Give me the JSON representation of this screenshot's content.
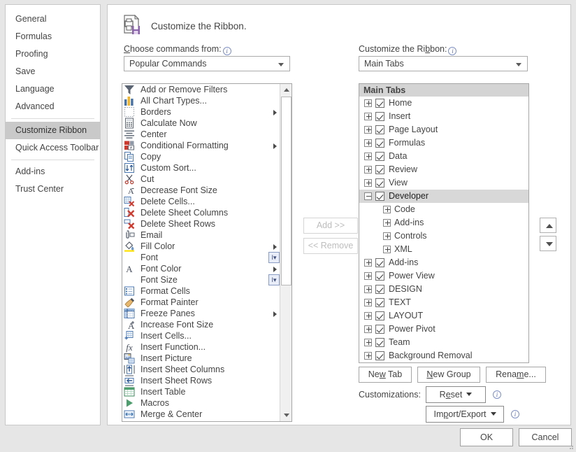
{
  "sidebar": {
    "items": [
      {
        "label": "General",
        "selected": false
      },
      {
        "label": "Formulas",
        "selected": false
      },
      {
        "label": "Proofing",
        "selected": false
      },
      {
        "label": "Save",
        "selected": false
      },
      {
        "label": "Language",
        "selected": false
      },
      {
        "label": "Advanced",
        "selected": false
      },
      {
        "label": "Customize Ribbon",
        "selected": true
      },
      {
        "label": "Quick Access Toolbar",
        "selected": false
      },
      {
        "label": "Add-ins",
        "selected": false
      },
      {
        "label": "Trust Center",
        "selected": false
      }
    ]
  },
  "header": {
    "title": "Customize the Ribbon.",
    "icon": "printer-save-icon"
  },
  "left_panel": {
    "label": "Choose commands from:",
    "label_accel": "C",
    "combo_value": "Popular Commands",
    "commands": [
      {
        "label": "Add or Remove Filters",
        "icon": "filter-icon",
        "submenu": false,
        "dropdown": false
      },
      {
        "label": "All Chart Types...",
        "icon": "chart-icon",
        "submenu": false,
        "dropdown": false
      },
      {
        "label": "Borders",
        "icon": "borders-icon",
        "submenu": true,
        "dropdown": false
      },
      {
        "label": "Calculate Now",
        "icon": "calculator-icon",
        "submenu": false,
        "dropdown": false
      },
      {
        "label": "Center",
        "icon": "center-align-icon",
        "submenu": false,
        "dropdown": false
      },
      {
        "label": "Conditional Formatting",
        "icon": "conditional-format-icon",
        "submenu": true,
        "dropdown": false
      },
      {
        "label": "Copy",
        "icon": "copy-icon",
        "submenu": false,
        "dropdown": false
      },
      {
        "label": "Custom Sort...",
        "icon": "sort-icon",
        "submenu": false,
        "dropdown": false
      },
      {
        "label": "Cut",
        "icon": "scissors-icon",
        "submenu": false,
        "dropdown": false
      },
      {
        "label": "Decrease Font Size",
        "icon": "decrease-font-icon",
        "submenu": false,
        "dropdown": false
      },
      {
        "label": "Delete Cells...",
        "icon": "delete-cells-icon",
        "submenu": false,
        "dropdown": false
      },
      {
        "label": "Delete Sheet Columns",
        "icon": "delete-columns-icon",
        "submenu": false,
        "dropdown": false
      },
      {
        "label": "Delete Sheet Rows",
        "icon": "delete-rows-icon",
        "submenu": false,
        "dropdown": false
      },
      {
        "label": "Email",
        "icon": "email-icon",
        "submenu": false,
        "dropdown": false
      },
      {
        "label": "Fill Color",
        "icon": "fill-color-icon",
        "submenu": true,
        "dropdown": false
      },
      {
        "label": "Font",
        "icon": "none",
        "submenu": false,
        "dropdown": true
      },
      {
        "label": "Font Color",
        "icon": "font-color-icon",
        "submenu": true,
        "dropdown": false
      },
      {
        "label": "Font Size",
        "icon": "none",
        "submenu": false,
        "dropdown": true
      },
      {
        "label": "Format Cells",
        "icon": "format-cells-icon",
        "submenu": false,
        "dropdown": false
      },
      {
        "label": "Format Painter",
        "icon": "format-painter-icon",
        "submenu": false,
        "dropdown": false
      },
      {
        "label": "Freeze Panes",
        "icon": "freeze-panes-icon",
        "submenu": true,
        "dropdown": false
      },
      {
        "label": "Increase Font Size",
        "icon": "increase-font-icon",
        "submenu": false,
        "dropdown": false
      },
      {
        "label": "Insert Cells...",
        "icon": "insert-cells-icon",
        "submenu": false,
        "dropdown": false
      },
      {
        "label": "Insert Function...",
        "icon": "function-icon",
        "submenu": false,
        "dropdown": false
      },
      {
        "label": "Insert Picture",
        "icon": "picture-icon",
        "submenu": false,
        "dropdown": false
      },
      {
        "label": "Insert Sheet Columns",
        "icon": "insert-columns-icon",
        "submenu": false,
        "dropdown": false
      },
      {
        "label": "Insert Sheet Rows",
        "icon": "insert-rows-icon",
        "submenu": false,
        "dropdown": false
      },
      {
        "label": "Insert Table",
        "icon": "table-icon",
        "submenu": false,
        "dropdown": false
      },
      {
        "label": "Macros",
        "icon": "macros-play-icon",
        "submenu": false,
        "dropdown": false
      },
      {
        "label": "Merge & Center",
        "icon": "merge-center-icon",
        "submenu": false,
        "dropdown": false
      }
    ]
  },
  "middle_buttons": {
    "add_label": "Add >>",
    "add_enabled": false,
    "remove_label": "<< Remove",
    "remove_enabled": false
  },
  "right_panel": {
    "label": "Customize the Ribbon:",
    "label_accel": "b",
    "combo_value": "Main Tabs",
    "tree_header": "Main Tabs",
    "tree": [
      {
        "label": "Home",
        "level": 0,
        "checked": true,
        "expander": "plus",
        "selected": false
      },
      {
        "label": "Insert",
        "level": 0,
        "checked": true,
        "expander": "plus",
        "selected": false
      },
      {
        "label": "Page Layout",
        "level": 0,
        "checked": true,
        "expander": "plus",
        "selected": false
      },
      {
        "label": "Formulas",
        "level": 0,
        "checked": true,
        "expander": "plus",
        "selected": false
      },
      {
        "label": "Data",
        "level": 0,
        "checked": true,
        "expander": "plus",
        "selected": false
      },
      {
        "label": "Review",
        "level": 0,
        "checked": true,
        "expander": "plus",
        "selected": false
      },
      {
        "label": "View",
        "level": 0,
        "checked": true,
        "expander": "plus",
        "selected": false
      },
      {
        "label": "Developer",
        "level": 0,
        "checked": true,
        "expander": "minus",
        "selected": true
      },
      {
        "label": "Code",
        "level": 1,
        "checked": false,
        "expander": "plus",
        "selected": false
      },
      {
        "label": "Add-ins",
        "level": 1,
        "checked": false,
        "expander": "plus",
        "selected": false
      },
      {
        "label": "Controls",
        "level": 1,
        "checked": false,
        "expander": "plus",
        "selected": false
      },
      {
        "label": "XML",
        "level": 1,
        "checked": false,
        "expander": "plus",
        "selected": false
      },
      {
        "label": "Add-ins",
        "level": 0,
        "checked": true,
        "expander": "plus",
        "selected": false
      },
      {
        "label": "Power View",
        "level": 0,
        "checked": true,
        "expander": "plus",
        "selected": false
      },
      {
        "label": "DESIGN",
        "level": 0,
        "checked": true,
        "expander": "plus",
        "selected": false
      },
      {
        "label": "TEXT",
        "level": 0,
        "checked": true,
        "expander": "plus",
        "selected": false
      },
      {
        "label": "LAYOUT",
        "level": 0,
        "checked": true,
        "expander": "plus",
        "selected": false
      },
      {
        "label": "Power Pivot",
        "level": 0,
        "checked": true,
        "expander": "plus",
        "selected": false
      },
      {
        "label": "Team",
        "level": 0,
        "checked": true,
        "expander": "plus",
        "selected": false
      },
      {
        "label": "Background Removal",
        "level": 0,
        "checked": true,
        "expander": "plus",
        "selected": false
      }
    ],
    "new_tab": "New Tab",
    "new_group": "New Group",
    "rename": "Rename...",
    "customizations_label": "Customizations:",
    "reset": "Reset",
    "import_export": "Import/Export"
  },
  "move_buttons": {
    "up": "move-up",
    "down": "move-down"
  },
  "footer": {
    "ok": "OK",
    "cancel": "Cancel"
  },
  "colors": {
    "dialog_bg": "#e6e6e6",
    "panel_bg": "#ffffff",
    "selection": "#c9c9c9",
    "tree_header_bg": "#d4d4d4",
    "text": "#444444",
    "accent_purple": "#8a62ab"
  }
}
